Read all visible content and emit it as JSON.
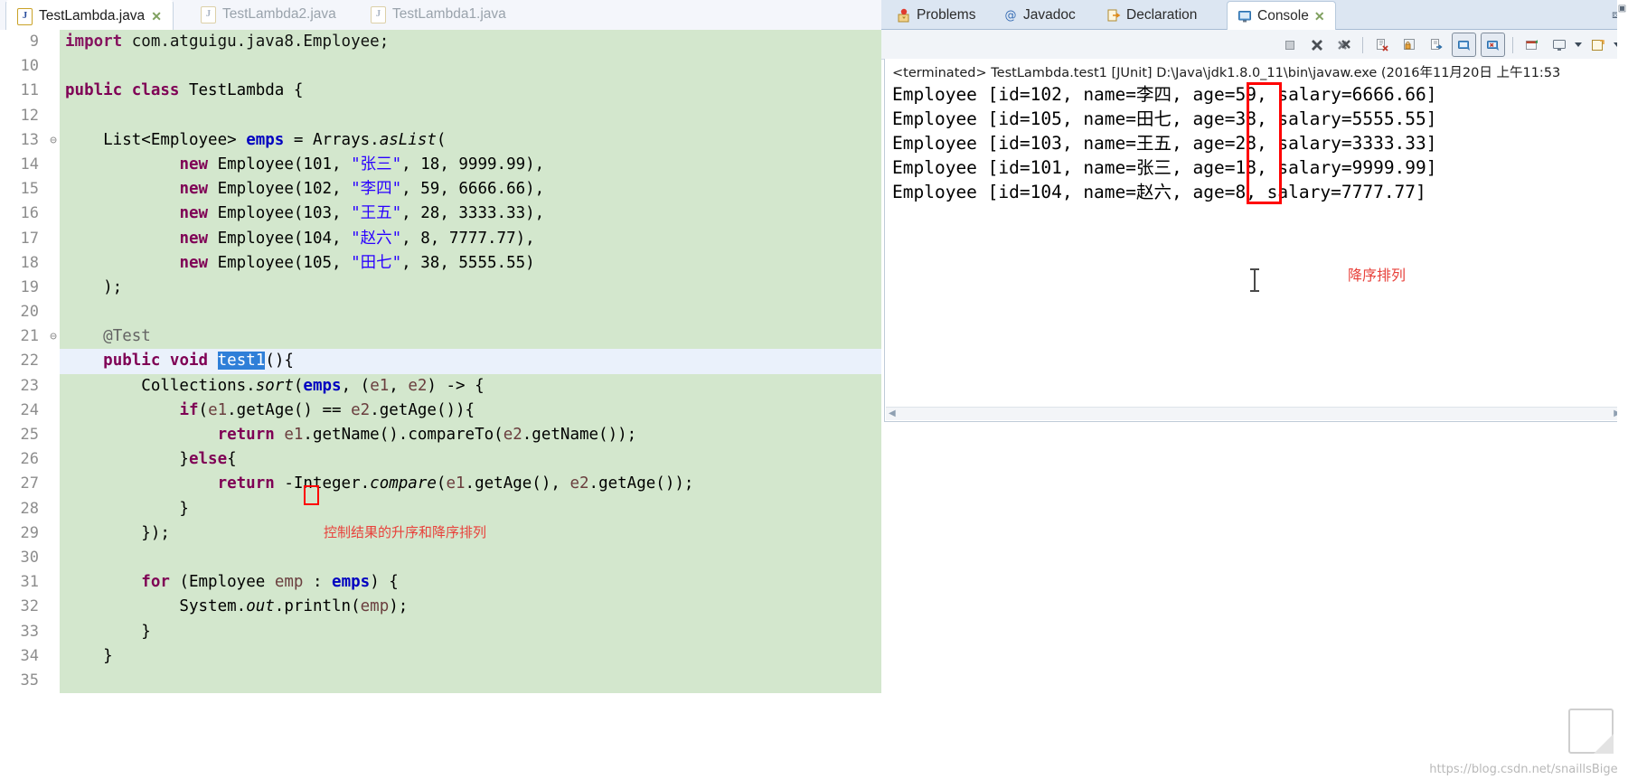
{
  "editor": {
    "tabs": [
      {
        "label": "TestLambda.java",
        "active": true,
        "close": "✕"
      },
      {
        "label": "TestLambda2.java",
        "active": false,
        "close": ""
      },
      {
        "label": "TestLambda1.java",
        "active": false,
        "close": ""
      }
    ],
    "lines": [
      {
        "num": "9",
        "fold": "",
        "text": "import com.atguigu.java8.Employee;",
        "partial": true
      },
      {
        "num": "10",
        "fold": "",
        "text": ""
      },
      {
        "num": "11",
        "fold": "",
        "text": "public class TestLambda {"
      },
      {
        "num": "12",
        "fold": "",
        "text": ""
      },
      {
        "num": "13",
        "fold": "⊖",
        "text": "    List<Employee> emps = Arrays.asList("
      },
      {
        "num": "14",
        "fold": "",
        "text": "            new Employee(101, \"张三\", 18, 9999.99),"
      },
      {
        "num": "15",
        "fold": "",
        "text": "            new Employee(102, \"李四\", 59, 6666.66),"
      },
      {
        "num": "16",
        "fold": "",
        "text": "            new Employee(103, \"王五\", 28, 3333.33),"
      },
      {
        "num": "17",
        "fold": "",
        "text": "            new Employee(104, \"赵六\", 8, 7777.77),"
      },
      {
        "num": "18",
        "fold": "",
        "text": "            new Employee(105, \"田七\", 38, 5555.55)"
      },
      {
        "num": "19",
        "fold": "",
        "text": "    );"
      },
      {
        "num": "20",
        "fold": "",
        "text": ""
      },
      {
        "num": "21",
        "fold": "⊖",
        "text": "    @Test"
      },
      {
        "num": "22",
        "fold": "",
        "text": "    public void test1(){",
        "current": true
      },
      {
        "num": "23",
        "fold": "",
        "text": "        Collections.sort(emps, (e1, e2) -> {"
      },
      {
        "num": "24",
        "fold": "",
        "text": "            if(e1.getAge() == e2.getAge()){"
      },
      {
        "num": "25",
        "fold": "",
        "text": "                return e1.getName().compareTo(e2.getName());"
      },
      {
        "num": "26",
        "fold": "",
        "text": "            }else{"
      },
      {
        "num": "27",
        "fold": "",
        "text": "                return -Integer.compare(e1.getAge(), e2.getAge());"
      },
      {
        "num": "28",
        "fold": "",
        "text": "            }"
      },
      {
        "num": "29",
        "fold": "",
        "text": "        });"
      },
      {
        "num": "30",
        "fold": "",
        "text": ""
      },
      {
        "num": "31",
        "fold": "",
        "text": "        for (Employee emp : emps) {"
      },
      {
        "num": "32",
        "fold": "",
        "text": "            System.out.println(emp);"
      },
      {
        "num": "33",
        "fold": "",
        "text": "        }"
      },
      {
        "num": "34",
        "fold": "",
        "text": "    }"
      },
      {
        "num": "35",
        "fold": "",
        "text": ""
      }
    ],
    "selected_token": "test1",
    "annotation": "控制结果的升序和降序排列",
    "annotation_color": "#e8413b",
    "background": "#d3e7cd",
    "current_line_background": "#eaf1fb"
  },
  "console": {
    "view_tabs": [
      {
        "label": "Problems",
        "icon": "problems-icon",
        "active": false
      },
      {
        "label": "Javadoc",
        "icon": "javadoc-icon",
        "active": false
      },
      {
        "label": "Declaration",
        "icon": "declaration-icon",
        "active": false
      },
      {
        "label": "Console",
        "icon": "console-icon",
        "active": true,
        "close": "✕"
      }
    ],
    "toolbar_buttons": [
      {
        "name": "terminate-button"
      },
      {
        "name": "remove-launch-button"
      },
      {
        "name": "remove-all-terminated-button"
      },
      {
        "name": "clear-console-button"
      },
      {
        "name": "scroll-lock-button"
      },
      {
        "name": "word-wrap-button"
      },
      {
        "name": "show-console-on-output-button",
        "pressed": true
      },
      {
        "name": "show-console-on-error-button",
        "pressed": true
      },
      {
        "name": "pin-console-button"
      },
      {
        "name": "display-selected-console-button"
      },
      {
        "name": "open-console-button"
      }
    ],
    "terminated_line": "<terminated> TestLambda.test1 [JUnit] D:\\Java\\jdk1.8.0_11\\bin\\javaw.exe (2016年11月20日 上午11:53",
    "output": [
      "Employee [id=102, name=李四, age=59, salary=6666.66]",
      "Employee [id=105, name=田七, age=38, salary=5555.55]",
      "Employee [id=103, name=王五, age=28, salary=3333.33]",
      "Employee [id=101, name=张三, age=18, salary=9999.99]",
      "Employee [id=104, name=赵六, age=8, salary=7777.77]"
    ],
    "annotation": "降序排列",
    "annotation_color": "#e8413b",
    "highlight_box_color": "#ff0000"
  },
  "watermark": "https://blog.csdn.net/snaillsBiger"
}
